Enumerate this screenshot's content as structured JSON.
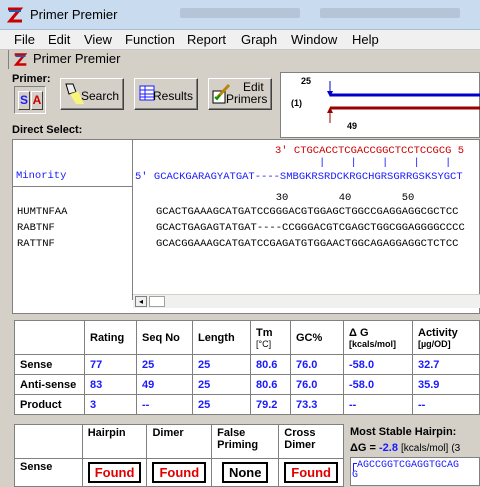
{
  "window": {
    "title": "Primer Premier"
  },
  "menu": [
    "File",
    "Edit",
    "View",
    "Function",
    "Report",
    "Graph",
    "Window",
    "Help"
  ],
  "child_window": {
    "title": "Primer Premier"
  },
  "toolbar": {
    "primer_label": "Primer:",
    "sense_btn": "S",
    "antisense_btn": "A",
    "search_label": "Search",
    "results_label": "Results",
    "edit_primers_label_1": "Edit",
    "edit_primers_label_2": "Primers",
    "direct_select_label": "Direct Select:"
  },
  "graph": {
    "top_pos": "25",
    "label": "(1)",
    "bottom_pos": "49",
    "colors": {
      "sense": "#0000cc",
      "antisense": "#990000"
    }
  },
  "sequence": {
    "antisense_primer": "3' CTGCACCTCGACCGGCTCCTCCGCG 5",
    "ruler_ticks": "|    |    |    |    |",
    "consensus_label": "Minority",
    "consensus": "5' GCACKGARAGYATGAT----SMBGKRSRDCKRGCHGRSGRRGSKSYGCT",
    "ruler_numbers": "                   30        40        50",
    "names": [
      "HUMTNFAA",
      "RABTNF",
      "RATTNF"
    ],
    "seqs": [
      "GCACTGAAAGCATGATCCGGGACGTGGAGCTGGCCGAGGAGGCGCTCC",
      "GCACTGAGAGTATGAT----CCGGGACGTCGAGCTGGCGGAGGGGCCCC",
      "GCACGGAAAGCATGATCCGAGATGTGGAACTGGCAGAGGAGGCTCTCC"
    ]
  },
  "results_table": {
    "headers": [
      "",
      "Rating",
      "Seq No",
      "Length",
      "Tm",
      "GC%",
      "Δ G",
      "Activity"
    ],
    "subheaders": [
      "",
      "",
      "",
      "",
      "[°C]",
      "",
      "[kcals/mol]",
      "[µg/OD]"
    ],
    "rows": [
      {
        "label": "Sense",
        "cells": [
          "77",
          "25",
          "25",
          "80.6",
          "76.0",
          "-58.0",
          "32.7"
        ]
      },
      {
        "label": "Anti-sense",
        "cells": [
          "83",
          "49",
          "25",
          "80.6",
          "76.0",
          "-58.0",
          "35.9"
        ]
      },
      {
        "label": "Product",
        "cells": [
          "3",
          "--",
          "25",
          "79.2",
          "73.3",
          "--",
          "--"
        ]
      }
    ]
  },
  "structure_table": {
    "headers": [
      "",
      "Hairpin",
      "Dimer",
      "False Priming",
      "Cross Dimer"
    ],
    "header_lines": [
      [
        "",
        ""
      ],
      [
        "Hairpin",
        ""
      ],
      [
        "Dimer",
        ""
      ],
      [
        "False",
        "Priming"
      ],
      [
        "Cross",
        "Dimer"
      ]
    ],
    "row_label": "Sense",
    "statuses": [
      "Found",
      "Found",
      "None",
      "Found"
    ]
  },
  "hairpin_panel": {
    "title": "Most Stable Hairpin:",
    "dg_prefix": "ΔG = ",
    "dg_value": "-2.8",
    "dg_unit": "[kcals/mol]",
    "dg_suffix": "(3",
    "seq_line": "AGCCGGTCGAGGTGCAG",
    "seq_g": "G"
  }
}
